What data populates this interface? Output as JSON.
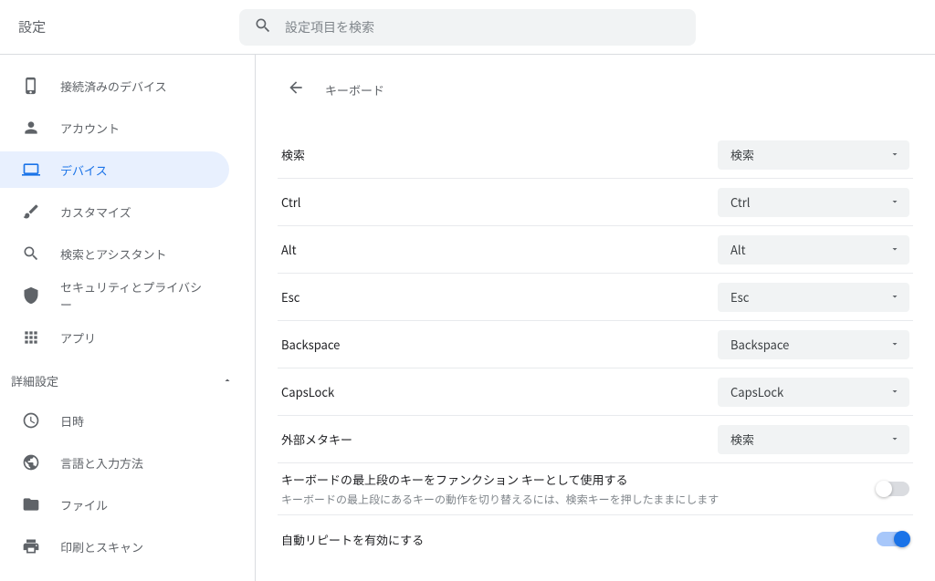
{
  "header": {
    "title": "設定",
    "search_placeholder": "設定項目を検索"
  },
  "sidebar": {
    "items": [
      {
        "id": "connected-devices",
        "label": "接続済みのデバイス",
        "icon": "phone"
      },
      {
        "id": "account",
        "label": "アカウント",
        "icon": "person"
      },
      {
        "id": "device",
        "label": "デバイス",
        "icon": "laptop",
        "active": true
      },
      {
        "id": "customize",
        "label": "カスタマイズ",
        "icon": "brush"
      },
      {
        "id": "search-assistant",
        "label": "検索とアシスタント",
        "icon": "search"
      },
      {
        "id": "security-privacy",
        "label": "セキュリティとプライバシー",
        "icon": "shield"
      },
      {
        "id": "apps",
        "label": "アプリ",
        "icon": "apps"
      }
    ],
    "advanced_label": "詳細設定",
    "advanced_items": [
      {
        "id": "datetime",
        "label": "日時",
        "icon": "clock"
      },
      {
        "id": "language-input",
        "label": "言語と入力方法",
        "icon": "globe"
      },
      {
        "id": "files",
        "label": "ファイル",
        "icon": "folder"
      },
      {
        "id": "print-scan",
        "label": "印刷とスキャン",
        "icon": "printer"
      }
    ]
  },
  "page": {
    "title": "キーボード",
    "keymap": [
      {
        "label": "検索",
        "value": "検索"
      },
      {
        "label": "Ctrl",
        "value": "Ctrl"
      },
      {
        "label": "Alt",
        "value": "Alt"
      },
      {
        "label": "Esc",
        "value": "Esc"
      },
      {
        "label": "Backspace",
        "value": "Backspace"
      },
      {
        "label": "CapsLock",
        "value": "CapsLock"
      },
      {
        "label": "外部メタキー",
        "value": "検索"
      }
    ],
    "toggles": [
      {
        "label": "キーボードの最上段のキーをファンクション キーとして使用する",
        "desc": "キーボードの最上段にあるキーの動作を切り替えるには、検索キーを押したままにします",
        "on": false
      },
      {
        "label": "自動リピートを有効にする",
        "desc": "",
        "on": true
      }
    ]
  }
}
